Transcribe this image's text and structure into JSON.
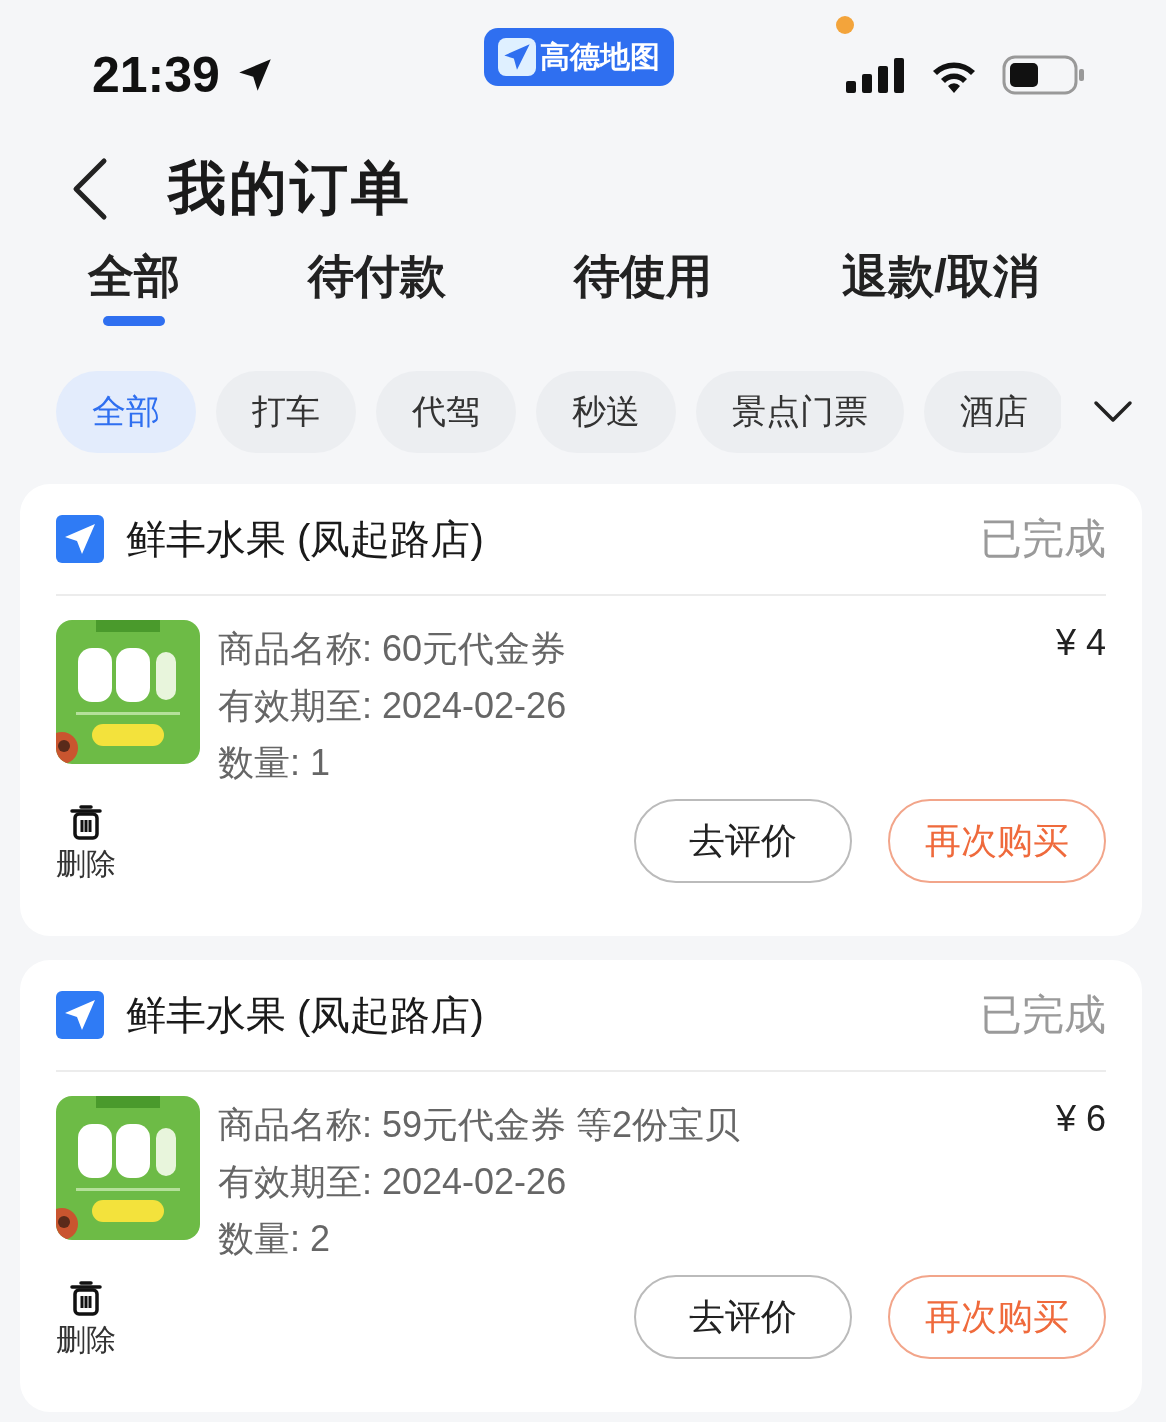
{
  "status_bar": {
    "time": "21:39",
    "back_app": "高德地图"
  },
  "header": {
    "title": "我的订单"
  },
  "tabs": [
    {
      "label": "全部",
      "selected": true
    },
    {
      "label": "待付款",
      "selected": false
    },
    {
      "label": "待使用",
      "selected": false
    },
    {
      "label": "退款/取消",
      "selected": false
    }
  ],
  "filters": [
    {
      "label": "全部",
      "selected": true
    },
    {
      "label": "打车",
      "selected": false
    },
    {
      "label": "代驾",
      "selected": false
    },
    {
      "label": "秒送",
      "selected": false
    },
    {
      "label": "景点门票",
      "selected": false
    },
    {
      "label": "酒店",
      "selected": false
    }
  ],
  "orders": [
    {
      "shop": "鲜丰水果 (凤起路店)",
      "status": "已完成",
      "image": {
        "kind": "picture"
      },
      "details": [
        "商品名称: 60元代金券",
        "有效期至: 2024-02-26",
        "数量: 1"
      ],
      "price": "¥ 4",
      "delete": "删除",
      "buttons": [
        {
          "label": "去评价",
          "kind": "plain"
        },
        {
          "label": "再次购买",
          "kind": "accent"
        }
      ]
    },
    {
      "shop": "鲜丰水果 (凤起路店)",
      "status": "已完成",
      "image": {
        "kind": "picture"
      },
      "details": [
        "商品名称: 59元代金券 等2份宝贝",
        "有效期至: 2024-02-26",
        "数量: 2"
      ],
      "price": "¥ 6",
      "delete": "删除",
      "buttons": [
        {
          "label": "去评价",
          "kind": "plain"
        },
        {
          "label": "再次购买",
          "kind": "accent"
        }
      ]
    }
  ]
}
